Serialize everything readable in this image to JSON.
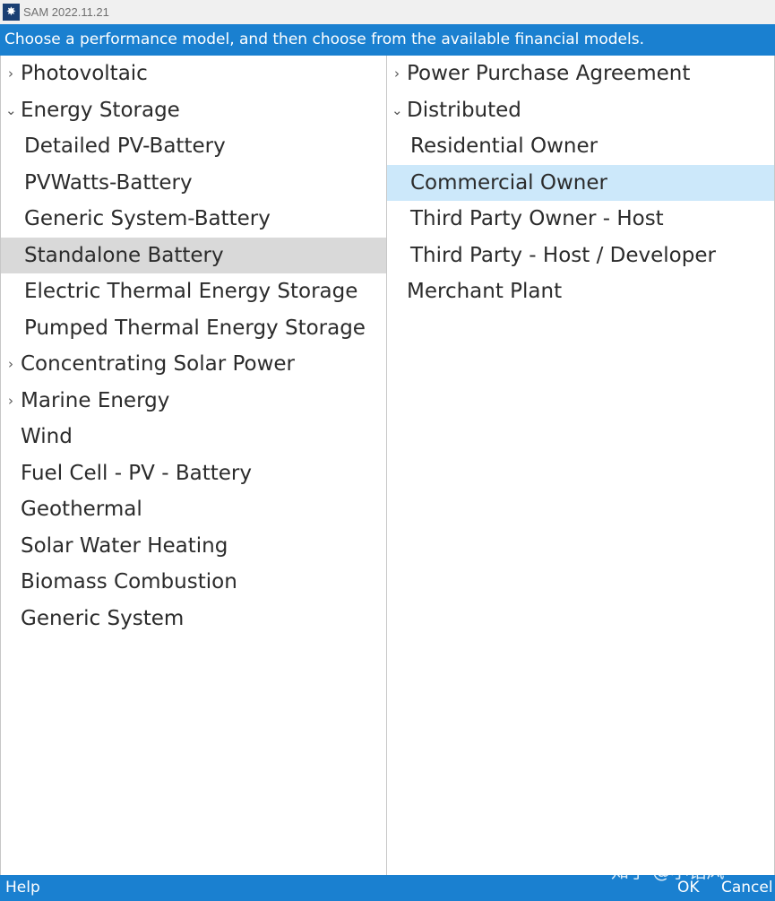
{
  "window": {
    "title": "SAM 2022.11.21",
    "logo_icon": "sam-sun-icon"
  },
  "banner": {
    "text": "Choose a performance model, and then choose from the available financial models."
  },
  "performance_models": [
    {
      "label": "Photovoltaic",
      "arrow": "›"
    },
    {
      "label": "Energy Storage",
      "arrow": "⌄"
    },
    {
      "label": "Detailed PV-Battery"
    },
    {
      "label": "PVWatts-Battery"
    },
    {
      "label": "Generic System-Battery"
    },
    {
      "label": "Standalone Battery"
    },
    {
      "label": "Electric Thermal Energy Storage"
    },
    {
      "label": "Pumped Thermal Energy Storage"
    },
    {
      "label": "Concentrating Solar Power",
      "arrow": "›"
    },
    {
      "label": "Marine Energy",
      "arrow": "›"
    },
    {
      "label": "Wind"
    },
    {
      "label": "Fuel Cell - PV - Battery"
    },
    {
      "label": "Geothermal"
    },
    {
      "label": "Solar Water Heating"
    },
    {
      "label": "Biomass Combustion"
    },
    {
      "label": "Generic System"
    }
  ],
  "financial_models": [
    {
      "label": "Power Purchase Agreement",
      "arrow": "›"
    },
    {
      "label": "Distributed",
      "arrow": "⌄"
    },
    {
      "label": "Residential Owner"
    },
    {
      "label": "Commercial Owner"
    },
    {
      "label": "Third Party Owner - Host"
    },
    {
      "label": "Third Party - Host / Developer"
    },
    {
      "label": "Merchant Plant"
    }
  ],
  "statusbar": {
    "help": "Help",
    "ok": "OK",
    "cancel": "Cancel"
  },
  "watermark": {
    "text": "知乎 @小钻风"
  },
  "colors": {
    "accent": "#1a80d0",
    "selected_gray": "#d9d9d9",
    "selected_blue": "#cce8fa"
  }
}
